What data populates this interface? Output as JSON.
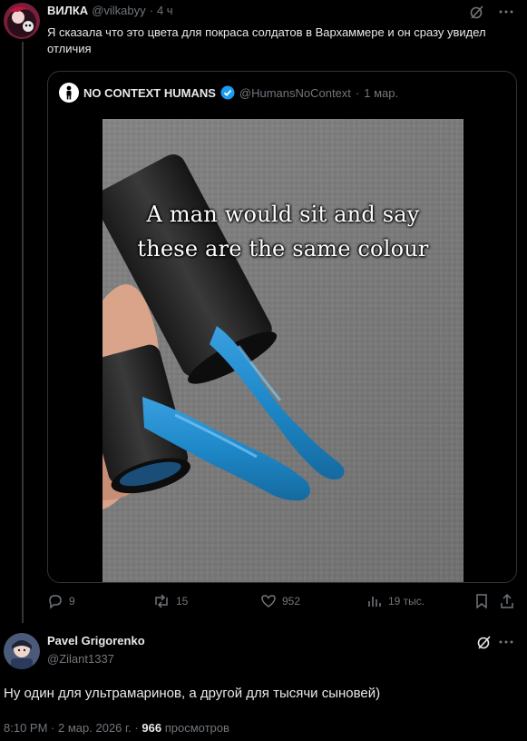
{
  "tweet1": {
    "name": "ВИЛКА",
    "handle": "@vilkabyy",
    "separator": "·",
    "time": "4 ч",
    "text": "Я сказала что это цвета для покраса солдатов в Вархаммере и он сразу увидел отличия"
  },
  "quote": {
    "name": "NO CONTEXT HUMANS",
    "handle": "@HumansNoContext",
    "separator": "·",
    "date": "1 мар.",
    "caption_line1": "A man would sit and say",
    "caption_line2": "these are the same colour"
  },
  "actions": {
    "replies": "9",
    "retweets": "15",
    "likes": "952",
    "views": "19 тыс."
  },
  "tweet2": {
    "name": "Pavel Grigorenko",
    "handle": "@Zilant1337",
    "text": "Ну один для ультрамаринов, а другой для тысячи сыновей)",
    "time": "8:10 PM",
    "separator1": "·",
    "date": "2 мар. 2026 г.",
    "separator2": "·",
    "views_count": "966",
    "views_label": "просмотров"
  },
  "colors": {
    "background": "#000000",
    "text": "#e7e9ea",
    "muted": "#71767b",
    "border": "#2f3336",
    "verified": "#1d9bf0",
    "nail_polish_blue": "#1e88c8"
  },
  "icons": [
    "grok-icon",
    "more-icon",
    "reply-icon",
    "retweet-icon",
    "like-icon",
    "views-icon",
    "bookmark-icon",
    "share-icon",
    "verified-icon"
  ]
}
